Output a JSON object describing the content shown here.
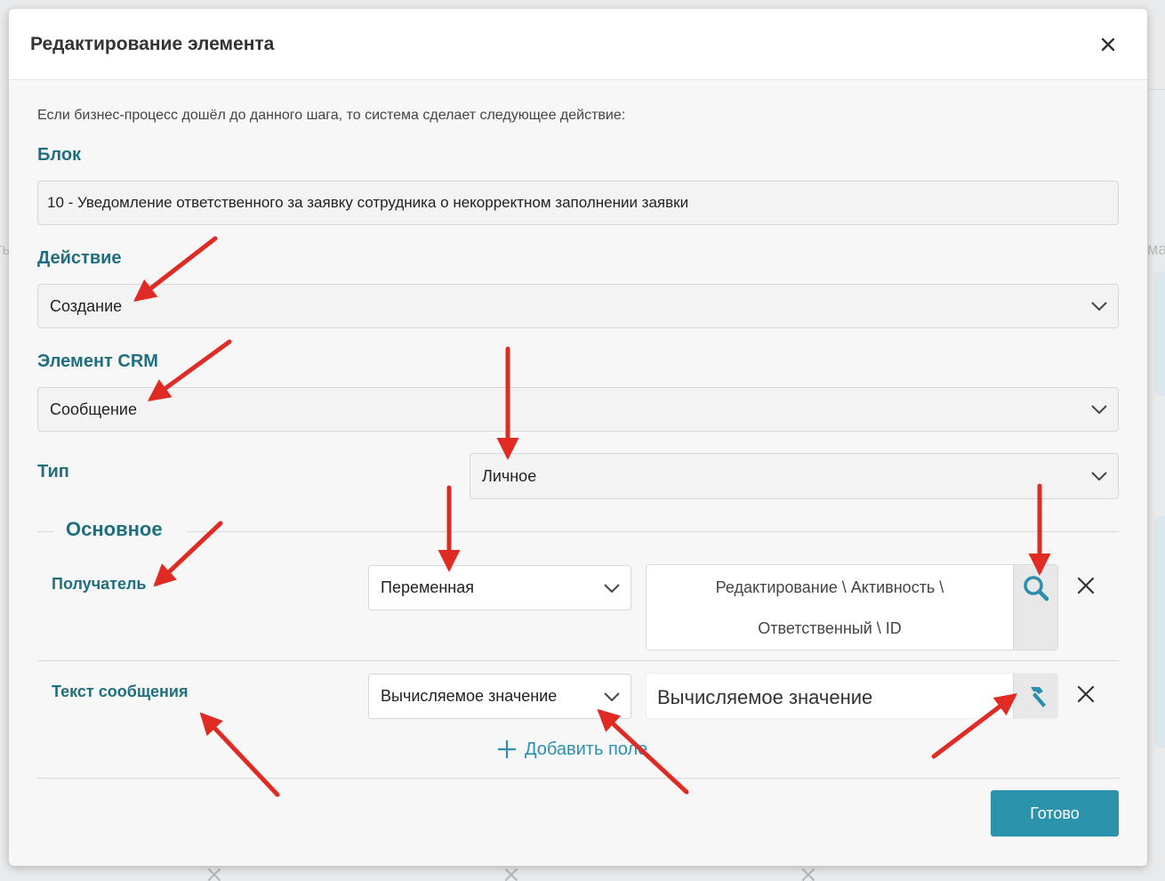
{
  "modal": {
    "title": "Редактирование элемента",
    "intro": "Если бизнес-процесс дошёл до данного шага, то система сделает следующее действие:"
  },
  "block": {
    "label": "Блок",
    "value": "10 - Уведомление ответственного за заявку сотрудника о некорректном заполнении заявки"
  },
  "action": {
    "label": "Действие",
    "value": "Создание"
  },
  "crm_element": {
    "label": "Элемент CRM",
    "value": "Сообщение"
  },
  "type": {
    "label": "Тип",
    "value": "Личное"
  },
  "section": {
    "title": "Основное"
  },
  "rows": [
    {
      "label": "Получатель",
      "source": "Переменная",
      "value_line1": "Редактирование \\ Активность \\",
      "value_line2": "Ответственный \\ ID",
      "button_icon": "search-icon"
    },
    {
      "label": "Текст сообщения",
      "source": "Вычисляемое значение",
      "value": "Вычисляемое значение",
      "button_icon": "hammer-icon"
    }
  ],
  "add_field_label": "Добавить поле",
  "done_label": "Готово",
  "background": {
    "left_fragment": "ть",
    "right_fragment": "ма"
  },
  "colors": {
    "accent": "#206f80",
    "button": "#2c93ad",
    "annotation_arrow": "#e02b25"
  }
}
